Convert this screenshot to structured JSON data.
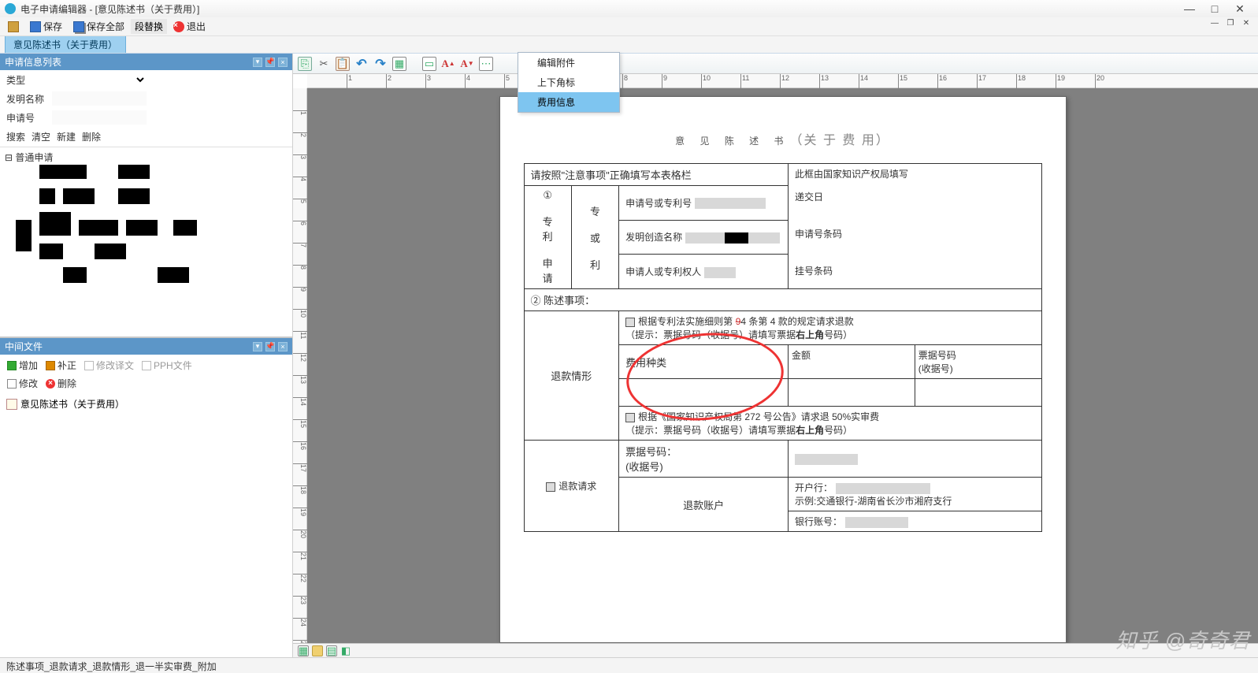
{
  "window": {
    "title": "电子申请编辑器 - [意见陈述书（关于费用）]"
  },
  "toolbar": {
    "save": "保存",
    "saveAll": "保存全部",
    "replace": "段替换",
    "exit": "退出"
  },
  "tab": {
    "label": "意见陈述书（关于费用）"
  },
  "leftPanel": {
    "header": "申请信息列表",
    "fields": {
      "type": "类型",
      "name": "发明名称",
      "appNo": "申请号"
    },
    "actions": {
      "search": "搜索",
      "clear": "清空",
      "new": "新建",
      "delete": "删除"
    },
    "treeRoot": "普通申请"
  },
  "midPanel": {
    "header": "中间文件",
    "btns": {
      "add": "增加",
      "supp": "补正",
      "trans": "修改译文",
      "pph": "PPH文件",
      "modify": "修改",
      "del": "删除"
    },
    "item": "意见陈述书（关于费用）"
  },
  "contextMenu": {
    "editAttach": "编辑附件",
    "supSub": "上下角标",
    "feeInfo": "费用信息"
  },
  "doc": {
    "title": "意 见 陈 述 书",
    "subtitle": "（关 于 费 用）",
    "instruction": "请按照\"注意事项\"正确填写本表格栏",
    "officeNote": "此框由国家知识产权局填写",
    "row1": {
      "num": "①",
      "side": "专　专\n利\n　　或\n申\n请　利",
      "appNo": "申请号或专利号",
      "invName": "发明创造名称",
      "applicant": "申请人或专利权人"
    },
    "office": {
      "submitDate": "递交日",
      "appBarcode": "申请号条码",
      "regBarcode": "挂号条码"
    },
    "row2": "② 陈述事项：",
    "refund": {
      "sideLabel": "退款情形",
      "rule1a": "根据专利法实施细则第",
      "rule1b": "4 条第 4 款的规定请求退款",
      "hint1": "（提示：票据号码（收据号）请填写票据",
      "hint1b": "右上角",
      "hint1c": "号码）",
      "feeType": "费用种类",
      "amount": "金额",
      "receiptNo": "票据号码\n(收据号)",
      "rule2": "根据《国家知识产权局第 272 号公告》请求退 50%实审费",
      "receiptLabel": "票据号码：\n(收据号)",
      "bank": "开户行：",
      "bankExample": "示例:交通银行-湖南省长沙市湘府支行",
      "refundReq": "退款请求",
      "refundAcct": "退款账户",
      "bankAcct": "银行账号："
    }
  },
  "status": "陈述事项_退款请求_退款情形_退一半实审费_附加",
  "watermark": "知乎 @奇奇君"
}
